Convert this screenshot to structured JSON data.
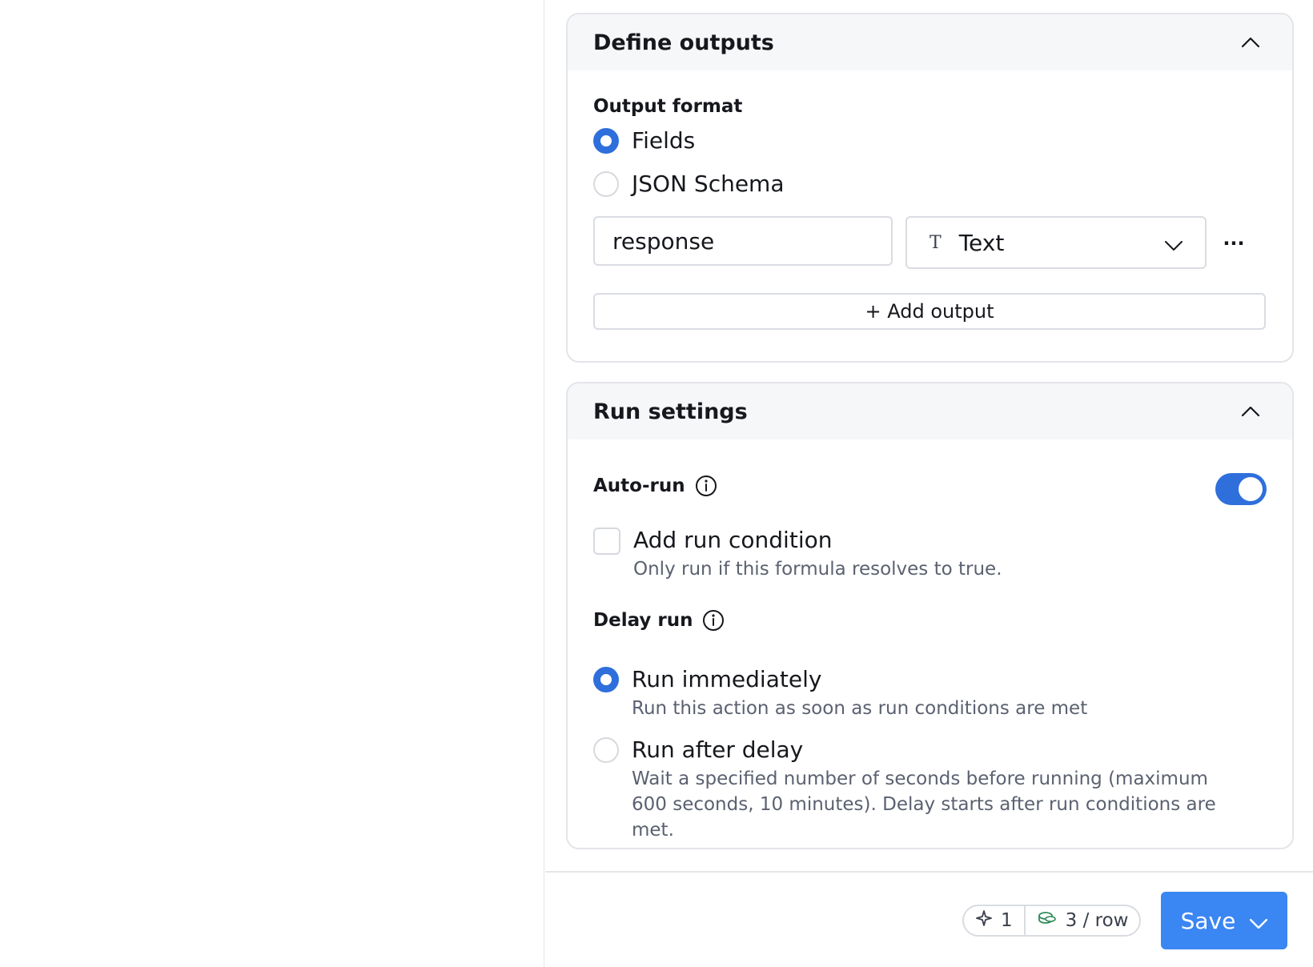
{
  "define_outputs": {
    "title": "Define outputs",
    "output_format_label": "Output format",
    "format_options": [
      {
        "label": "Fields",
        "selected": true
      },
      {
        "label": "JSON Schema",
        "selected": false
      }
    ],
    "field_name_value": "response",
    "field_type": {
      "icon_glyph": "T",
      "value": "Text"
    },
    "more_glyph": "···",
    "add_output_label": "+ Add output"
  },
  "run_settings": {
    "title": "Run settings",
    "auto_run_label": "Auto-run",
    "auto_run_on": true,
    "run_condition": {
      "label": "Add run condition",
      "description": "Only run if this formula resolves to true.",
      "checked": false
    },
    "delay_run_label": "Delay run",
    "delay_options": [
      {
        "label": "Run immediately",
        "description": "Run this action as soon as run conditions are met",
        "selected": true
      },
      {
        "label": "Run after delay",
        "description": "Wait a specified number of seconds before running (maximum 600 seconds, 10 minutes). Delay starts after run conditions are met.",
        "selected": false
      }
    ]
  },
  "footer": {
    "sparkle_count": "1",
    "credits_label": "3 / row",
    "save_label": "Save"
  },
  "colors": {
    "accent": "#2f6fdc",
    "save_button": "#3a86f2"
  }
}
